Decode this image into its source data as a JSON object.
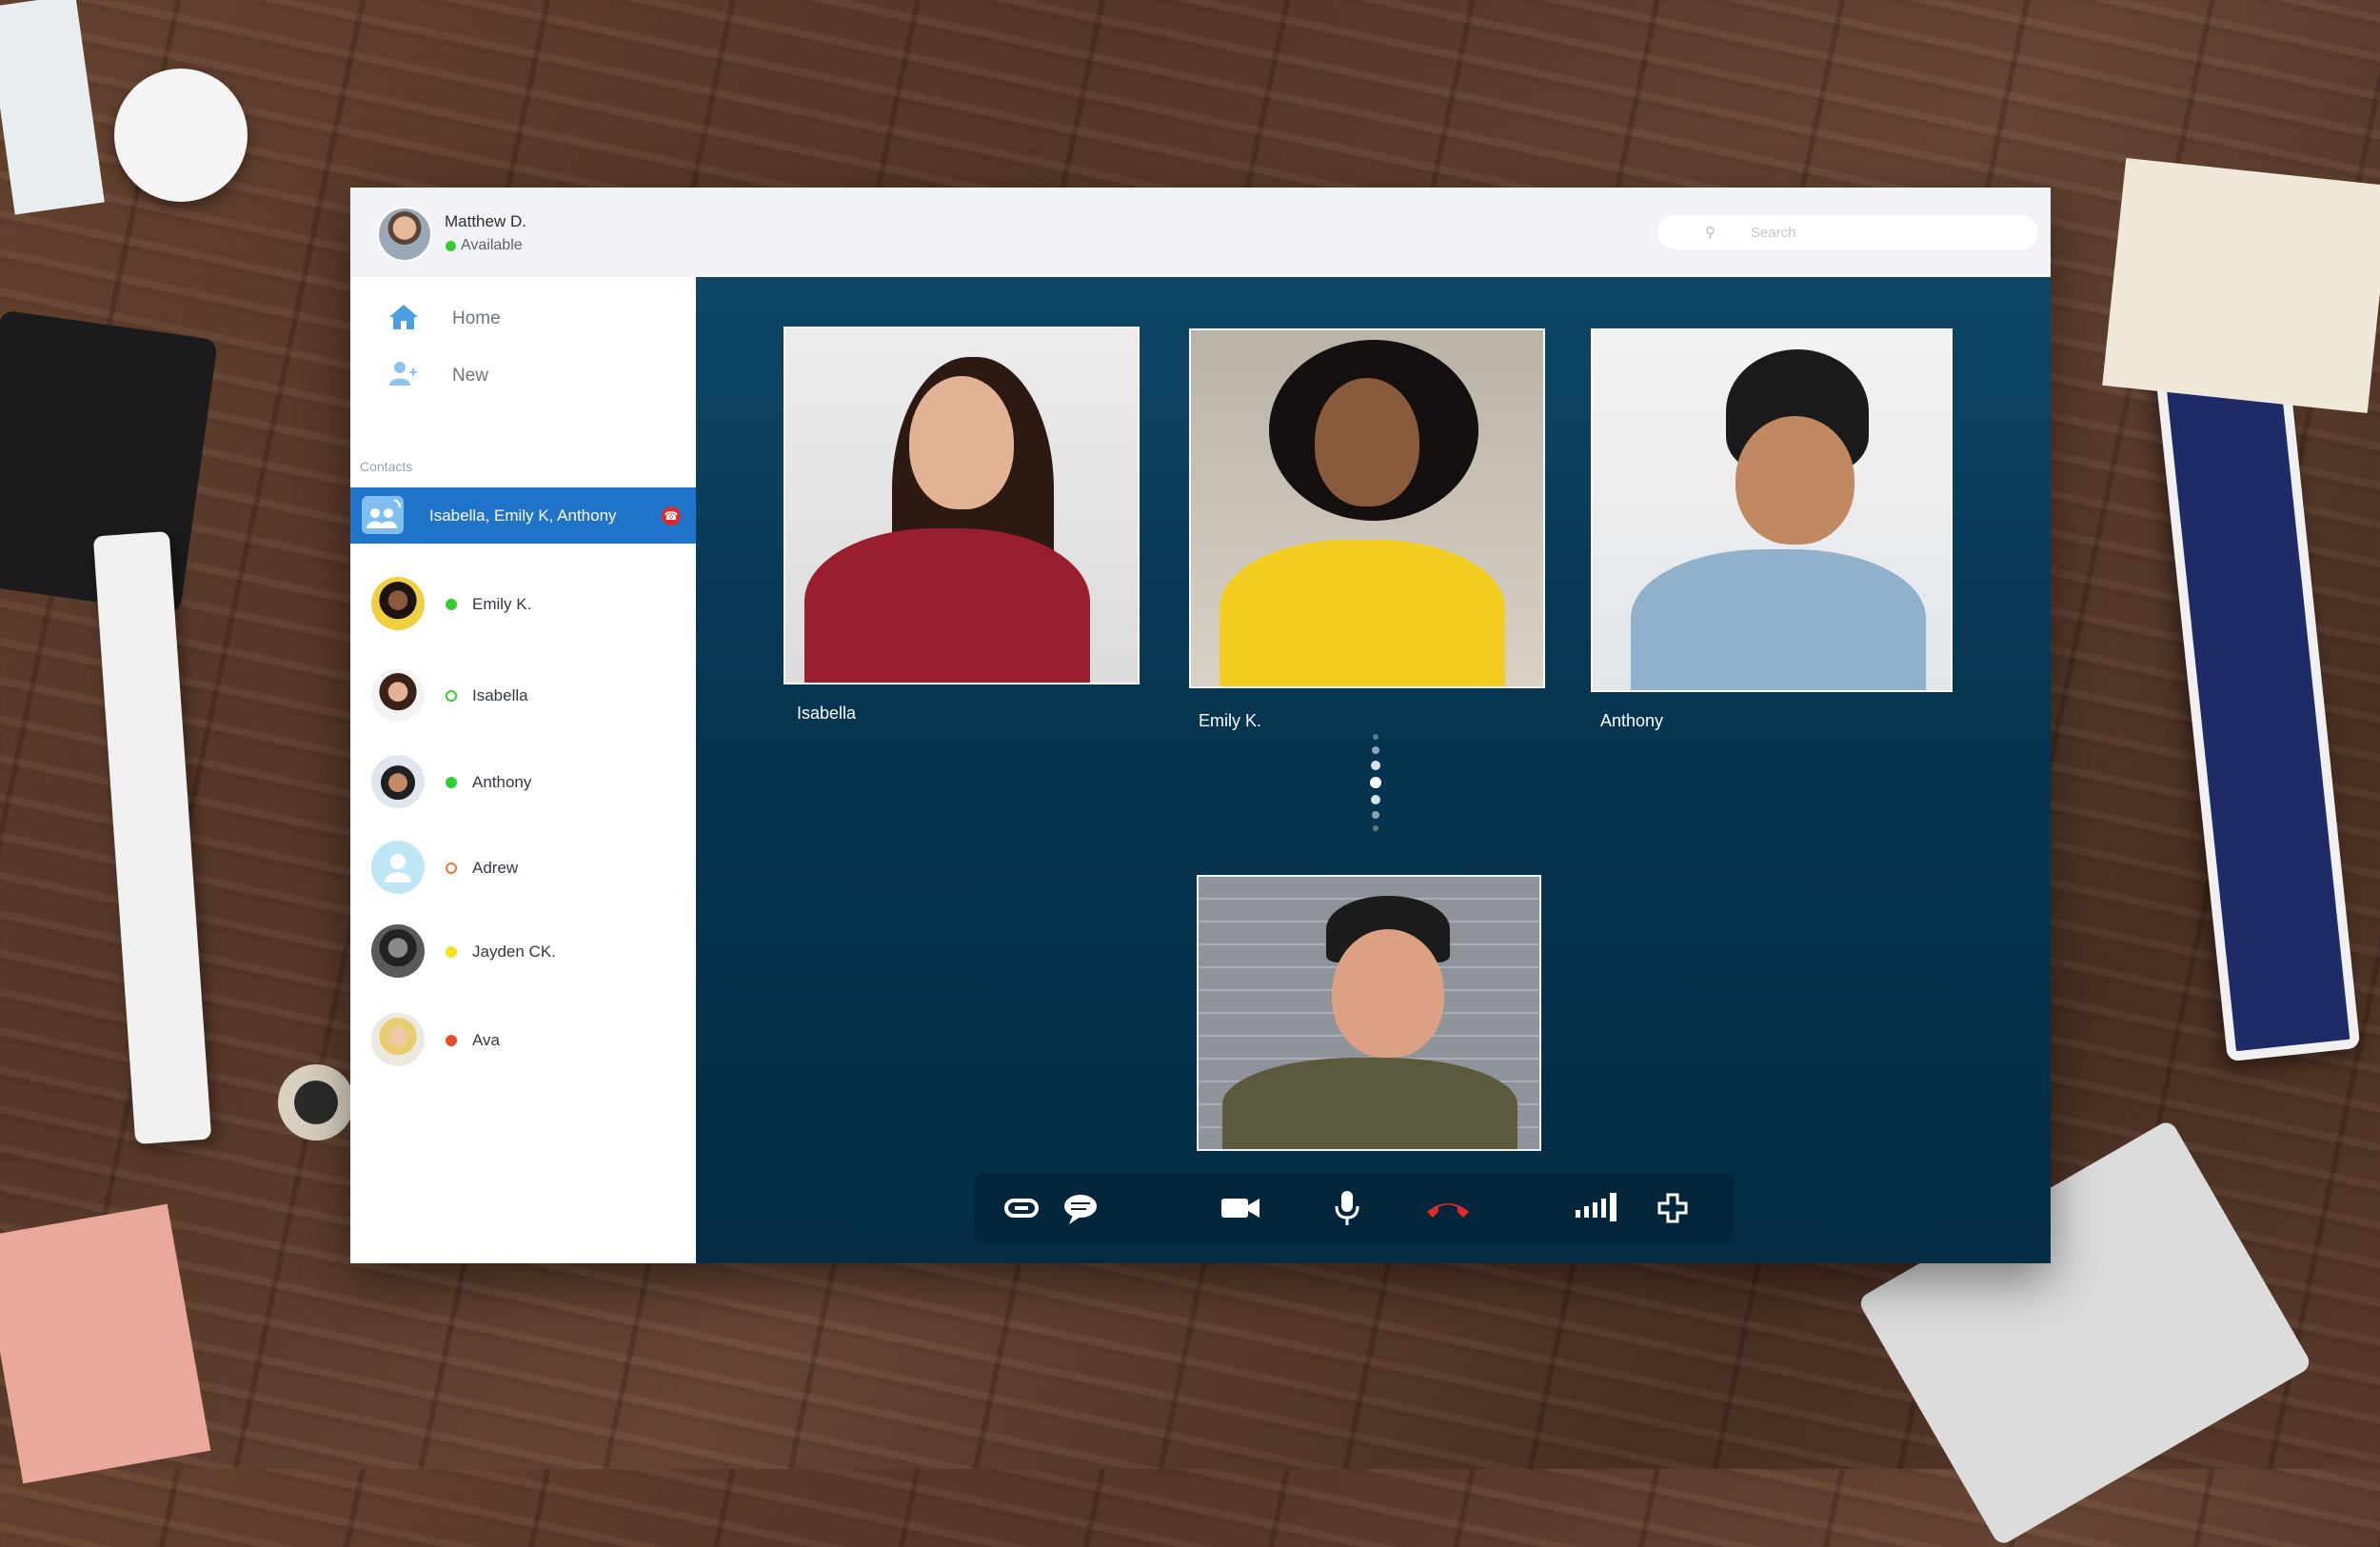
{
  "user": {
    "name": "Matthew D.",
    "status": "Available",
    "status_color": "#33cc33"
  },
  "search": {
    "placeholder": "Search"
  },
  "nav": [
    {
      "label": "Home",
      "icon": "home-icon"
    },
    {
      "label": "New",
      "icon": "add-contact-icon"
    }
  ],
  "contacts_heading": "Contacts",
  "active_call": {
    "label": "Isabella, Emily K, Anthony",
    "icon": "group-call-icon",
    "end_icon": "hangup-icon"
  },
  "contacts": [
    {
      "name": "Emily K.",
      "status": "online",
      "status_color": "#33cc33"
    },
    {
      "name": "Isabella",
      "status": "offline",
      "status_color": "#33cc33"
    },
    {
      "name": "Anthony",
      "status": "online",
      "status_color": "#33cc33"
    },
    {
      "name": "Adrew",
      "status": "offline",
      "status_color": "#e07a3a"
    },
    {
      "name": "Jayden CK.",
      "status": "away",
      "status_color": "#f5e21a"
    },
    {
      "name": "Ava",
      "status": "busy",
      "status_color": "#e0502a"
    }
  ],
  "videos": [
    {
      "name": "Isabella"
    },
    {
      "name": "Emily K."
    },
    {
      "name": "Anthony"
    }
  ],
  "controls": [
    {
      "name": "link-button",
      "icon": "link-icon"
    },
    {
      "name": "chat-button",
      "icon": "chat-bubble-icon"
    },
    {
      "name": "camera-button",
      "icon": "video-camera-icon"
    },
    {
      "name": "microphone-button",
      "icon": "microphone-icon"
    },
    {
      "name": "end-call-button",
      "icon": "hangup-icon",
      "color": "#e02a2a"
    },
    {
      "name": "signal-button",
      "icon": "signal-strength-icon"
    },
    {
      "name": "add-participant-button",
      "icon": "plus-icon"
    }
  ],
  "colors": {
    "accent": "#1f73c9",
    "stage": "#063551"
  }
}
